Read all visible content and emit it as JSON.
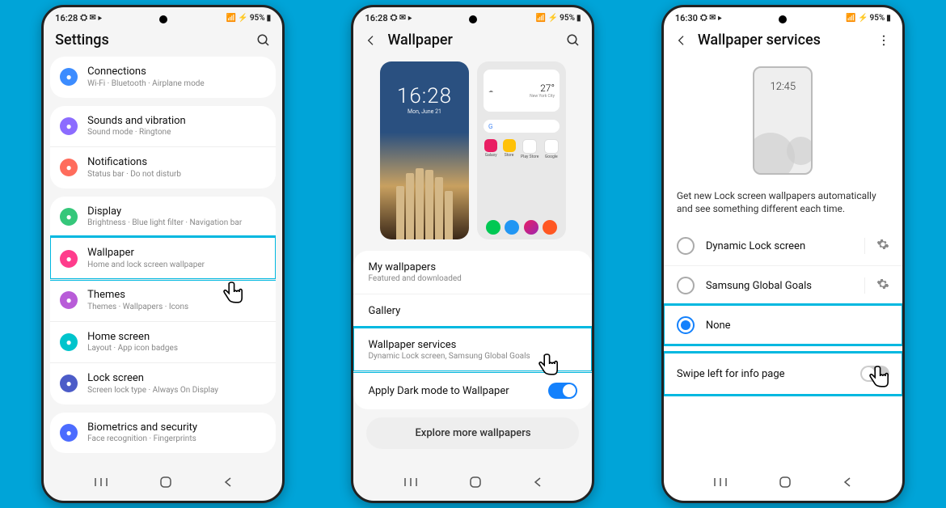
{
  "phone1": {
    "status": {
      "time": "16:28",
      "battery": "95%"
    },
    "title": "Settings",
    "groups": [
      {
        "items": [
          {
            "icon_color": "#3c8cff",
            "title": "Connections",
            "sub": "Wi-Fi · Bluetooth · Airplane mode",
            "name": "connections"
          }
        ]
      },
      {
        "items": [
          {
            "icon_color": "#8c6cff",
            "title": "Sounds and vibration",
            "sub": "Sound mode · Ringtone",
            "name": "sounds"
          },
          {
            "icon_color": "#ff6c5c",
            "title": "Notifications",
            "sub": "Status bar · Do not disturb",
            "name": "notifications"
          }
        ]
      },
      {
        "items": [
          {
            "icon_color": "#35c77a",
            "title": "Display",
            "sub": "Brightness · Blue light filter · Navigation bar",
            "name": "display"
          },
          {
            "icon_color": "#ff3c8c",
            "title": "Wallpaper",
            "sub": "Home and lock screen wallpaper",
            "highlight": true,
            "name": "wallpaper"
          },
          {
            "icon_color": "#b85cd8",
            "title": "Themes",
            "sub": "Themes · Wallpapers · Icons",
            "name": "themes"
          },
          {
            "icon_color": "#00c4cc",
            "title": "Home screen",
            "sub": "Layout · App icon badges",
            "name": "home-screen"
          },
          {
            "icon_color": "#4c5cc8",
            "title": "Lock screen",
            "sub": "Screen lock type · Always On Display",
            "name": "lock-screen"
          }
        ]
      },
      {
        "items": [
          {
            "icon_color": "#4c6cff",
            "title": "Biometrics and security",
            "sub": "Face recognition · Fingerprints",
            "name": "biometrics"
          }
        ]
      }
    ]
  },
  "phone2": {
    "status": {
      "time": "16:28",
      "battery": "95%"
    },
    "title": "Wallpaper",
    "lock_time": "16:28",
    "lock_date": "Mon, June 21",
    "weather_temp": "27°",
    "weather_city": "New York City",
    "rows": [
      {
        "title": "My wallpapers",
        "sub": "Featured and downloaded",
        "name": "my-wallpapers"
      },
      {
        "title": "Gallery",
        "name": "gallery"
      },
      {
        "title": "Wallpaper services",
        "sub": "Dynamic Lock screen, Samsung Global Goals",
        "highlight": true,
        "name": "wallpaper-services"
      },
      {
        "title": "Apply Dark mode to Wallpaper",
        "toggle": true,
        "name": "dark-mode"
      }
    ],
    "explore": "Explore more wallpapers"
  },
  "phone3": {
    "status": {
      "time": "16:30",
      "battery": "95%"
    },
    "title": "Wallpaper services",
    "mock_time": "12:45",
    "info": "Get new Lock screen wallpapers automatically and see something different each time.",
    "options": [
      {
        "label": "Dynamic Lock screen",
        "selected": false,
        "gear": true
      },
      {
        "label": "Samsung Global Goals",
        "selected": false,
        "gear": true
      },
      {
        "label": "None",
        "selected": true,
        "highlight": true
      }
    ],
    "swipe": {
      "label": "Swipe left for info page",
      "highlight": true
    }
  }
}
